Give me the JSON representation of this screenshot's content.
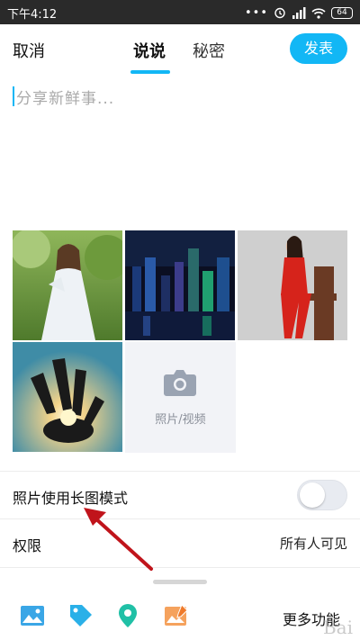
{
  "statusbar": {
    "time": "下午4:12",
    "battery": "64"
  },
  "header": {
    "cancel_label": "取消",
    "tabs": [
      {
        "label": "说说",
        "active": true
      },
      {
        "label": "秘密",
        "active": false
      }
    ],
    "publish_label": "发表"
  },
  "editor": {
    "placeholder": "分享新鲜事..."
  },
  "photos": [
    {
      "subject": "woman in white dress outdoors"
    },
    {
      "subject": "night city skyline with reflections"
    },
    {
      "subject": "woman in red seated on chair"
    },
    {
      "subject": "hand silhouette against sun"
    }
  ],
  "add_media": {
    "label": "照片/视频",
    "icon": "camera-icon"
  },
  "settings": {
    "long_image_label": "照片使用长图模式",
    "long_image_enabled": false,
    "permission_label": "权限",
    "permission_value": "所有人可见"
  },
  "toolbar": {
    "icons": [
      "image-icon",
      "tag-icon",
      "location-icon",
      "photo-edit-icon"
    ],
    "more_label": "更多功能"
  },
  "colors": {
    "accent": "#12b7f5",
    "annotation_arrow": "#c0141b"
  },
  "watermark": "Bai"
}
